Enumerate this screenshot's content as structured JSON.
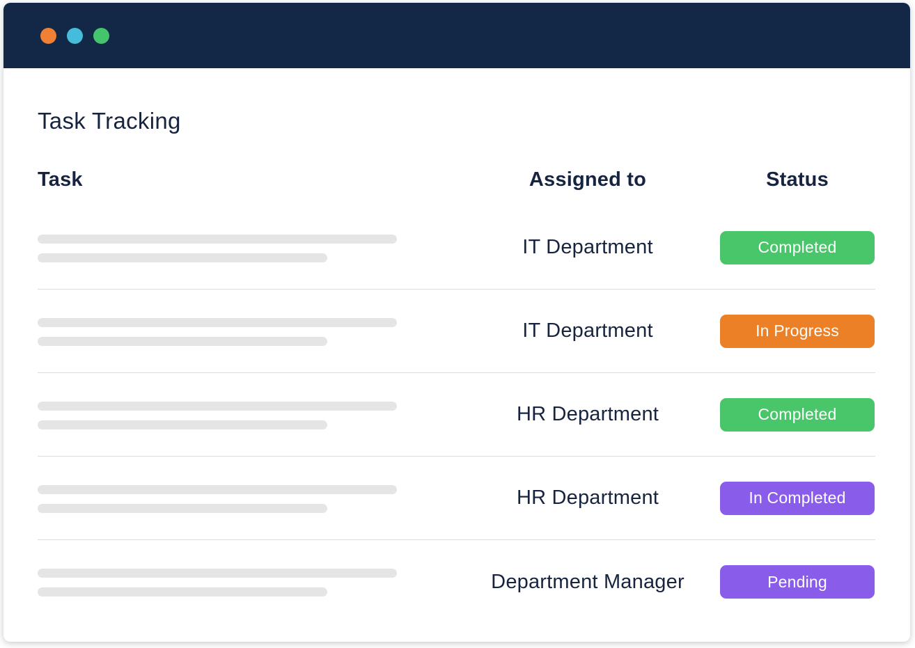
{
  "window": {
    "titlebar": {
      "color": "#132847",
      "buttons": [
        {
          "name": "close-button",
          "color": "#f08033"
        },
        {
          "name": "minimize-button",
          "color": "#45bcdb"
        },
        {
          "name": "maximize-button",
          "color": "#44c46c"
        }
      ]
    }
  },
  "page": {
    "title": "Task Tracking"
  },
  "table": {
    "columns": [
      {
        "key": "task",
        "label": "Task"
      },
      {
        "key": "assigned",
        "label": "Assigned to"
      },
      {
        "key": "status",
        "label": "Status"
      }
    ],
    "rows": [
      {
        "task_placeholder": true,
        "assigned_to": "IT Department",
        "status": "Completed",
        "status_color": "#4ac66a"
      },
      {
        "task_placeholder": true,
        "assigned_to": "IT Department",
        "status": "In Progress",
        "status_color": "#ec8026"
      },
      {
        "task_placeholder": true,
        "assigned_to": "HR Department",
        "status": "Completed",
        "status_color": "#4ac66a"
      },
      {
        "task_placeholder": true,
        "assigned_to": "HR Department",
        "status": "In Completed",
        "status_color": "#8a5cea"
      },
      {
        "task_placeholder": true,
        "assigned_to": "Department Manager",
        "status": "Pending",
        "status_color": "#8a5cea"
      }
    ]
  },
  "theme": {
    "text_dark": "#17243f",
    "skeleton": "#e5e5e5",
    "row_divider": "#d9dde3",
    "card_background": "#ffffff"
  }
}
